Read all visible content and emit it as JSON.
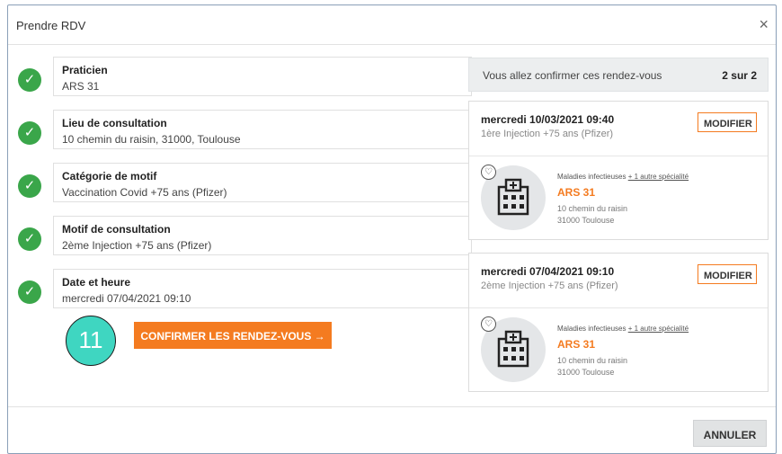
{
  "modal": {
    "title": "Prendre RDV",
    "close": "×"
  },
  "steps": [
    {
      "title": "Praticien",
      "value": "ARS 31"
    },
    {
      "title": "Lieu de consultation",
      "value": "10 chemin du raisin, 31000, Toulouse"
    },
    {
      "title": "Catégorie de motif",
      "value": "Vaccination Covid +75 ans (Pfizer)"
    },
    {
      "title": "Motif de consultation",
      "value": "2ème Injection +75 ans (Pfizer)"
    },
    {
      "title": "Date et heure",
      "value": "mercredi 07/04/2021 09:10"
    }
  ],
  "annotation_badge": "11",
  "confirm_label": "CONFIRMER LES RENDEZ-VOUS →",
  "summary": {
    "text": "Vous allez confirmer ces rendez-vous",
    "count": "2 sur 2"
  },
  "appointments": [
    {
      "date": "mercredi 10/03/2021 09:40",
      "motif": "1ère Injection +75 ans (Pfizer)",
      "modify_label": "MODIFIER",
      "specialty": "Maladies infectieuses",
      "specialty_more": "+ 1 autre spécialité",
      "name": "ARS 31",
      "address1": "10 chemin du raisin",
      "address2": "31000 Toulouse"
    },
    {
      "date": "mercredi 07/04/2021 09:10",
      "motif": "2ème Injection +75 ans (Pfizer)",
      "modify_label": "MODIFIER",
      "specialty": "Maladies infectieuses",
      "specialty_more": "+ 1 autre spécialité",
      "name": "ARS 31",
      "address1": "10 chemin du raisin",
      "address2": "31000 Toulouse"
    }
  ],
  "cancel_label": "ANNULER",
  "icons": {
    "check": "check-icon",
    "heart": "heart-icon",
    "hospital": "hospital-icon"
  },
  "colors": {
    "accent": "#f47b20",
    "success": "#3aa64a",
    "badge": "#3fd6c1"
  }
}
